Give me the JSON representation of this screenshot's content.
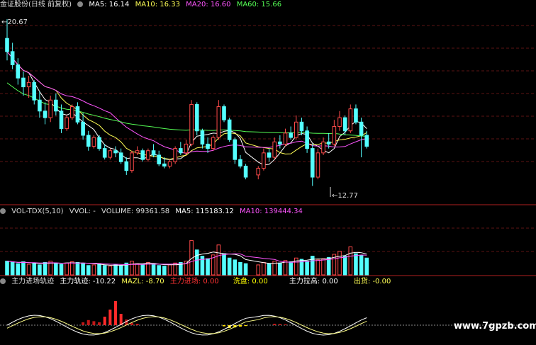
{
  "header": {
    "title": "金证股份(日线 前复权)",
    "ma5": "MA5: 16.14",
    "ma10": "MA10: 16.33",
    "ma20": "MA20: 16.60",
    "ma60": "MA60: 15.66"
  },
  "annotations": {
    "high": "20.67",
    "low": "12.77"
  },
  "vol_header": {
    "name": "VOL-TDX(5,10)",
    "vvol": "VVOL: -",
    "volume": "VOLUME: 99361.58",
    "ma5": "MA5: 115183.12",
    "ma10": "MA10: 139444.34"
  },
  "ind_header": {
    "name": "主力进场轨迹",
    "track": "主力轨迹: -10.22",
    "mazl": "MAZL: -8.70",
    "enter": "主力进场: 0.00",
    "wash": "洗盘: 0.00",
    "pull": "主力拉高: 0.00",
    "exit": "出货: -0.00"
  },
  "watermark": "www.7gpzb.com",
  "colors": {
    "up": "#ff4a4a",
    "down": "#54ffff",
    "ma5": "#ffffff",
    "ma10": "#ffff55",
    "ma20": "#ff55ff",
    "ma60": "#55ff55",
    "grid": "#7a1c1c"
  },
  "chart_data": [
    {
      "type": "candlestick",
      "name": "price",
      "ohlc": [
        [
          19.8,
          20.67,
          18.8,
          19.2
        ],
        [
          19.2,
          19.6,
          18.4,
          18.6
        ],
        [
          18.6,
          18.9,
          17.7,
          18.0
        ],
        [
          18.0,
          18.3,
          17.2,
          17.6
        ],
        [
          17.6,
          18.1,
          17.1,
          17.8
        ],
        [
          17.8,
          17.9,
          16.8,
          17.0
        ],
        [
          17.0,
          17.4,
          16.2,
          16.5
        ],
        [
          16.5,
          16.9,
          15.9,
          16.2
        ],
        [
          16.2,
          17.2,
          16.0,
          17.0
        ],
        [
          17.0,
          17.3,
          16.3,
          16.5
        ],
        [
          16.5,
          16.8,
          15.5,
          15.7
        ],
        [
          15.7,
          16.3,
          15.6,
          16.2
        ],
        [
          16.2,
          16.8,
          16.1,
          16.7
        ],
        [
          16.7,
          16.9,
          15.9,
          16.0
        ],
        [
          16.0,
          16.4,
          15.2,
          15.4
        ],
        [
          15.4,
          15.6,
          14.7,
          14.9
        ],
        [
          14.9,
          15.4,
          14.8,
          15.3
        ],
        [
          15.3,
          15.4,
          14.7,
          14.8
        ],
        [
          14.8,
          15.0,
          14.3,
          14.4
        ],
        [
          14.4,
          14.8,
          14.3,
          14.7
        ],
        [
          14.7,
          14.9,
          14.4,
          14.6
        ],
        [
          14.6,
          14.8,
          14.1,
          14.2
        ],
        [
          14.2,
          14.4,
          13.6,
          13.8
        ],
        [
          13.8,
          14.7,
          13.7,
          14.6
        ],
        [
          14.6,
          14.9,
          14.5,
          14.7
        ],
        [
          14.7,
          14.8,
          14.2,
          14.3
        ],
        [
          14.3,
          14.8,
          14.2,
          14.7
        ],
        [
          14.7,
          15.0,
          14.4,
          14.5
        ],
        [
          14.5,
          14.7,
          14.0,
          14.1
        ],
        [
          14.1,
          14.4,
          13.9,
          14.0
        ],
        [
          14.0,
          14.3,
          13.9,
          14.2
        ],
        [
          14.2,
          14.9,
          14.1,
          14.8
        ],
        [
          14.8,
          15.1,
          14.5,
          14.6
        ],
        [
          14.6,
          15.2,
          14.5,
          15.0
        ],
        [
          15.0,
          17.0,
          14.9,
          16.8
        ],
        [
          16.8,
          16.9,
          15.4,
          15.6
        ],
        [
          15.6,
          15.7,
          14.8,
          15.0
        ],
        [
          15.0,
          15.3,
          14.6,
          14.8
        ],
        [
          14.8,
          15.4,
          14.7,
          15.3
        ],
        [
          15.3,
          17.0,
          15.2,
          16.7
        ],
        [
          16.7,
          16.8,
          16.0,
          16.1
        ],
        [
          16.1,
          16.2,
          15.1,
          15.2
        ],
        [
          15.2,
          15.3,
          14.1,
          14.3
        ],
        [
          14.3,
          14.5,
          13.9,
          14.0
        ],
        [
          14.0,
          14.1,
          13.4,
          13.5
        ],
        [
          13.6,
          14.0,
          13.4,
          13.9
        ],
        [
          13.9,
          14.8,
          13.8,
          14.6
        ],
        [
          14.6,
          14.8,
          14.2,
          14.4
        ],
        [
          14.4,
          15.3,
          14.3,
          15.1
        ],
        [
          15.1,
          15.4,
          14.8,
          15.0
        ],
        [
          15.0,
          15.7,
          14.9,
          15.5
        ],
        [
          15.5,
          15.8,
          15.2,
          15.3
        ],
        [
          15.3,
          16.3,
          15.2,
          16.0
        ],
        [
          16.0,
          16.2,
          15.4,
          15.6
        ],
        [
          15.6,
          15.8,
          14.6,
          14.8
        ],
        [
          14.8,
          15.0,
          13.1,
          13.5
        ],
        [
          13.5,
          14.8,
          13.4,
          14.6
        ],
        [
          14.6,
          15.3,
          14.5,
          15.1
        ],
        [
          15.1,
          15.5,
          14.8,
          15.0
        ],
        [
          15.0,
          16.1,
          14.9,
          15.8
        ],
        [
          15.8,
          16.5,
          15.6,
          16.2
        ],
        [
          16.2,
          16.3,
          15.4,
          15.6
        ],
        [
          15.6,
          16.8,
          15.5,
          16.6
        ],
        [
          16.6,
          16.8,
          15.9,
          16.0
        ],
        [
          16.0,
          16.2,
          14.4,
          15.4
        ],
        [
          15.4,
          15.6,
          14.8,
          14.9
        ]
      ],
      "ma5_last": 16.14,
      "ma10_last": 16.33,
      "ma20_last": 16.6,
      "ma60_last": 15.66,
      "high_label": 20.67,
      "low_label": 12.77
    },
    {
      "type": "bar",
      "name": "volume",
      "values": [
        0.22,
        0.2,
        0.18,
        0.21,
        0.17,
        0.19,
        0.16,
        0.2,
        0.22,
        0.18,
        0.17,
        0.19,
        0.21,
        0.2,
        0.18,
        0.15,
        0.16,
        0.17,
        0.15,
        0.14,
        0.16,
        0.15,
        0.19,
        0.22,
        0.18,
        0.16,
        0.2,
        0.17,
        0.15,
        0.14,
        0.16,
        0.19,
        0.2,
        0.22,
        0.55,
        0.4,
        0.3,
        0.26,
        0.32,
        0.48,
        0.34,
        0.27,
        0.24,
        0.2,
        0.18,
        0.16,
        0.2,
        0.18,
        0.22,
        0.19,
        0.23,
        0.21,
        0.27,
        0.25,
        0.22,
        0.3,
        0.24,
        0.26,
        0.28,
        0.33,
        0.38,
        0.3,
        0.45,
        0.34,
        0.31,
        0.27
      ]
    },
    {
      "type": "bar",
      "name": "main_force_track",
      "values": [
        0,
        0,
        0,
        0,
        0,
        0,
        0,
        0,
        0,
        0,
        0,
        0,
        0,
        0,
        0.1,
        0.18,
        0.14,
        0.1,
        0.3,
        0.55,
        0.85,
        0.4,
        0.2,
        0.08,
        0.05,
        0,
        0,
        0,
        0,
        0,
        0,
        0,
        0,
        0,
        0,
        0,
        0,
        0,
        0,
        0,
        -0.04,
        -0.1,
        -0.08,
        -0.05,
        -0.03,
        0,
        0,
        0,
        0.05,
        0.04,
        0.03,
        0,
        0,
        0,
        0,
        0,
        0,
        0,
        0,
        0,
        0,
        0,
        0,
        0,
        0,
        0
      ]
    }
  ]
}
